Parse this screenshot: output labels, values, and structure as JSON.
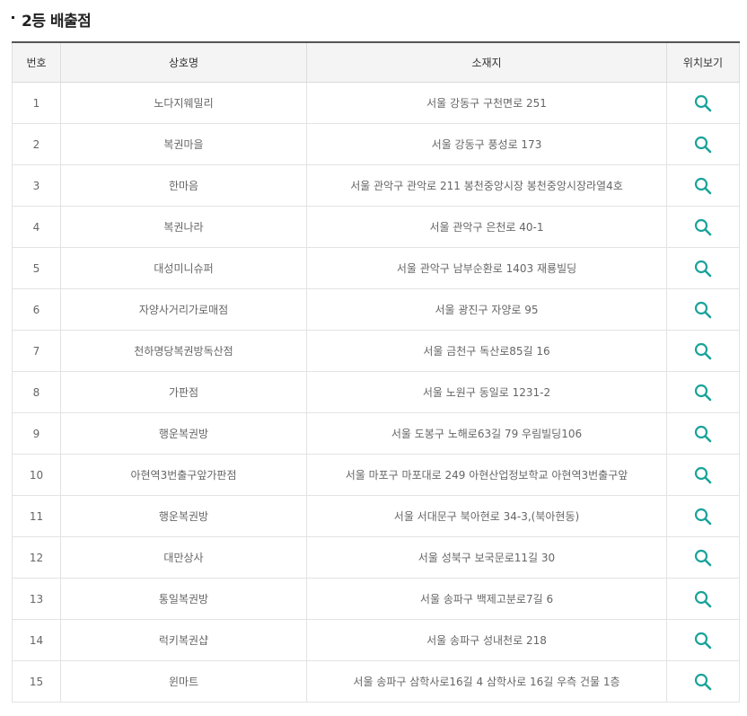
{
  "section": {
    "title": "2등 배출점"
  },
  "table": {
    "headers": {
      "no": "번호",
      "name": "상호명",
      "address": "소재지",
      "map": "위치보기"
    },
    "rows": [
      {
        "no": "1",
        "name": "노다지웨밀리",
        "address": "서울 강동구 구천면로 251"
      },
      {
        "no": "2",
        "name": "복권마을",
        "address": "서울 강동구 풍성로 173"
      },
      {
        "no": "3",
        "name": "한마음",
        "address": "서울 관악구 관악로 211 봉천중앙시장 봉천중앙시장라열4호"
      },
      {
        "no": "4",
        "name": "복권나라",
        "address": "서울 관악구 은천로 40-1"
      },
      {
        "no": "5",
        "name": "대성미니슈퍼",
        "address": "서울 관악구 남부순환로 1403 재룡빌딩"
      },
      {
        "no": "6",
        "name": "자양사거리가로매점",
        "address": "서울 광진구 자양로 95"
      },
      {
        "no": "7",
        "name": "천하명당복권방독산점",
        "address": "서울 금천구 독산로85길 16"
      },
      {
        "no": "8",
        "name": "가판점",
        "address": "서울 노원구 동일로 1231-2"
      },
      {
        "no": "9",
        "name": "행운복권방",
        "address": "서울 도봉구 노해로63길 79 우림빌딩106"
      },
      {
        "no": "10",
        "name": "아현역3번출구앞가판점",
        "address": "서울 마포구 마포대로 249 아현산업정보학교 아현역3번출구앞"
      },
      {
        "no": "11",
        "name": "행운복권방",
        "address": "서울 서대문구 북아현로 34-3,(북아현동)"
      },
      {
        "no": "12",
        "name": "대만상사",
        "address": "서울 성북구 보국문로11길 30"
      },
      {
        "no": "13",
        "name": "통일복권방",
        "address": "서울 송파구 백제고분로7길 6"
      },
      {
        "no": "14",
        "name": "럭키복권샵",
        "address": "서울 송파구 성내천로 218"
      },
      {
        "no": "15",
        "name": "윈마트",
        "address": "서울 송파구 삼학사로16길 4 삼학사로 16길 우측 건물 1층"
      }
    ]
  },
  "icons": {
    "map": "search-icon"
  },
  "colors": {
    "icon": "#1aa39a",
    "header_bg": "#f4f4f4",
    "top_border": "#555555"
  }
}
